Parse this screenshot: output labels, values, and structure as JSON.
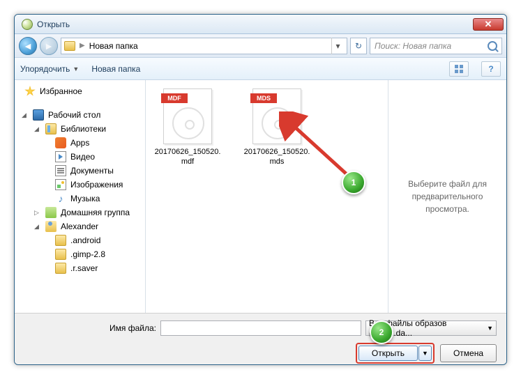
{
  "window": {
    "title": "Открыть"
  },
  "nav": {
    "path": "Новая папка",
    "search_placeholder": "Поиск: Новая папка"
  },
  "toolbar": {
    "organize": "Упорядочить",
    "newfolder": "Новая папка"
  },
  "sidebar": {
    "favorites": "Избранное",
    "desktop": "Рабочий стол",
    "libraries": "Библиотеки",
    "apps": "Apps",
    "video": "Видео",
    "documents": "Документы",
    "images": "Изображения",
    "music": "Музыка",
    "homegroup": "Домашняя группа",
    "user": "Alexander",
    "f_android": ".android",
    "f_gimp": ".gimp-2.8",
    "f_rsaver": ".r.saver"
  },
  "files": [
    {
      "badge": "MDF",
      "name": "20170626_150520.mdf"
    },
    {
      "badge": "MDS",
      "name": "20170626_150520.mds"
    }
  ],
  "preview": {
    "text": "Выберите файл для предварительного просмотра."
  },
  "bottom": {
    "filename_label": "Имя файла:",
    "filename_value": "",
    "filter": "Все файлы образов (*.iso;*.da...",
    "open": "Открыть",
    "cancel": "Отмена"
  },
  "annotations": {
    "num1": "1",
    "num2": "2"
  }
}
